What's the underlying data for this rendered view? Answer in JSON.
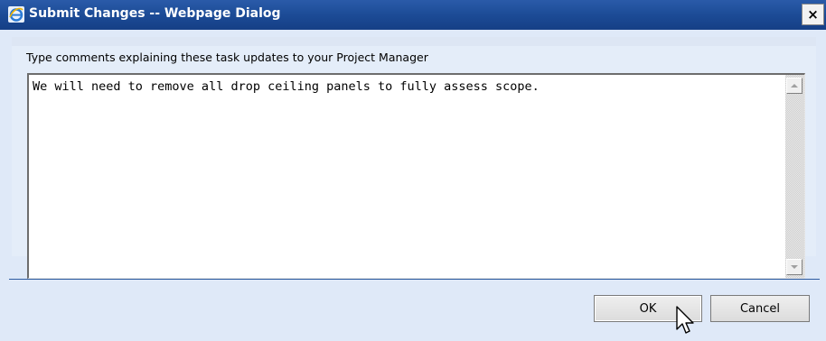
{
  "window": {
    "title": "Submit Changes -- Webpage Dialog",
    "close_label": "×"
  },
  "form": {
    "prompt": "Type comments explaining these task updates to your Project Manager",
    "comment": "We will need to remove all drop ceiling panels to fully assess scope."
  },
  "buttons": {
    "ok": "OK",
    "cancel": "Cancel"
  },
  "icons": {
    "title": "internet-explorer-icon",
    "close": "close-icon",
    "scroll_up": "scroll-up-arrow-icon",
    "scroll_down": "scroll-down-arrow-icon",
    "pointer": "mouse-pointer-icon"
  },
  "colors": {
    "titlebar": "#1c4b96",
    "dialog_background": "#dfe9f8",
    "separator": "#2c5aa0"
  }
}
